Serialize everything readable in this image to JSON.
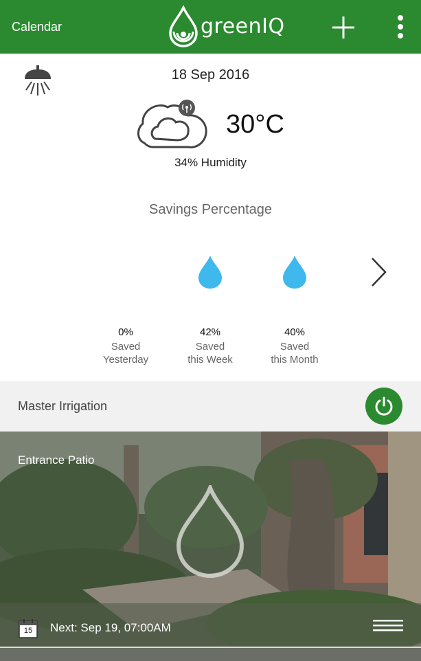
{
  "header": {
    "calendar_label": "Calendar",
    "app_name": "greenIQ",
    "add_icon": "plus-icon",
    "menu_icon": "more-vert-icon",
    "color": "#2b8a30"
  },
  "weather": {
    "lamp_icon": "lamp-icon",
    "date": "18 Sep 2016",
    "icon": "cloud-icon",
    "temperature": "30°C",
    "humidity": "34% Humidity"
  },
  "savings": {
    "title": "Savings Percentage",
    "items": [
      {
        "percent": "0%",
        "label_line1": "Saved",
        "label_line2": "Yesterday",
        "level": 0.0
      },
      {
        "percent": "42%",
        "label_line1": "Saved",
        "label_line2": "this Week",
        "level": 0.42
      },
      {
        "percent": "40%",
        "label_line1": "Saved",
        "label_line2": "this Month",
        "level": 0.4
      }
    ],
    "drop_color": "#3fb8ee",
    "next_icon": "chevron-right-icon"
  },
  "master": {
    "label": "Master Irrigation",
    "power_icon": "power-icon"
  },
  "zone": {
    "name": "Entrance Patio",
    "calendar_day": "15",
    "next": "Next: Sep 19, 07:00AM",
    "menu_icon": "hamburger-icon"
  }
}
